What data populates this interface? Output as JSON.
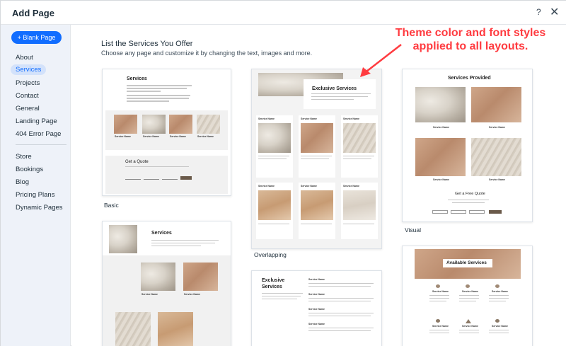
{
  "dialog": {
    "title": "Add Page",
    "help_label": "?",
    "close_label": "✕"
  },
  "sidebar": {
    "blank_page_label": "+ Blank Page",
    "items": [
      {
        "label": "About"
      },
      {
        "label": "Services",
        "active": true
      },
      {
        "label": "Projects"
      },
      {
        "label": "Contact"
      },
      {
        "label": "General"
      },
      {
        "label": "Landing Page"
      },
      {
        "label": "404 Error Page"
      },
      {
        "label": "Store"
      },
      {
        "label": "Bookings"
      },
      {
        "label": "Blog"
      },
      {
        "label": "Pricing Plans"
      },
      {
        "label": "Dynamic Pages"
      }
    ]
  },
  "main": {
    "heading": "List the Services You Offer",
    "subheading": "Choose any page and customize it by changing the text, images and more."
  },
  "templates": {
    "basic": {
      "label": "Basic",
      "title": "Services",
      "service_name": "Service Name",
      "quote_title": "Get a Quote"
    },
    "overlapping": {
      "label": "Overlapping",
      "title": "Exclusive Services",
      "service_name": "Service Name"
    },
    "visual": {
      "label": "Visual",
      "title": "Services Provided",
      "service_name": "Service Name",
      "quote_title": "Get a Free Quote"
    },
    "card4": {
      "title": "Services",
      "service_name": "Service Name"
    },
    "card5": {
      "title_line1": "Exclusive",
      "title_line2": "Services",
      "service_name": "Service Name"
    },
    "card6": {
      "title": "Available Services",
      "service_name": "Service Name"
    }
  },
  "annotation": {
    "line1": "Theme color and font styles",
    "line2": "applied to all layouts.",
    "color": "#ff3b40"
  },
  "colors": {
    "accent": "#116dff",
    "sidebar_bg": "#eef2f9",
    "active_bg": "#d3e2fb"
  }
}
